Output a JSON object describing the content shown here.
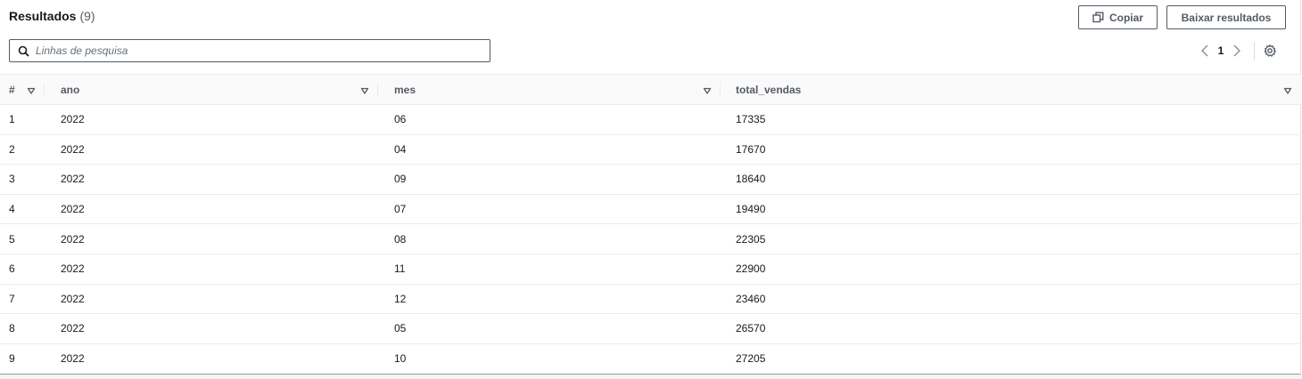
{
  "header": {
    "title": "Resultados",
    "count": "(9)",
    "copy_label": "Copiar",
    "download_label": "Baixar resultados"
  },
  "search": {
    "placeholder": "Linhas de pesquisa",
    "value": ""
  },
  "pagination": {
    "current_page": "1"
  },
  "table": {
    "columns": [
      "#",
      "ano",
      "mes",
      "total_vendas"
    ],
    "rows": [
      [
        "1",
        "2022",
        "06",
        "17335"
      ],
      [
        "2",
        "2022",
        "04",
        "17670"
      ],
      [
        "3",
        "2022",
        "09",
        "18640"
      ],
      [
        "4",
        "2022",
        "07",
        "19490"
      ],
      [
        "5",
        "2022",
        "08",
        "22305"
      ],
      [
        "6",
        "2022",
        "11",
        "22900"
      ],
      [
        "7",
        "2022",
        "12",
        "23460"
      ],
      [
        "8",
        "2022",
        "05",
        "26570"
      ],
      [
        "9",
        "2022",
        "10",
        "27205"
      ]
    ]
  },
  "icons": {
    "copy": "copy-icon",
    "search": "search-icon",
    "prev": "chevron-left-icon",
    "next": "chevron-right-icon",
    "settings": "gear-icon",
    "sort": "sort-down-icon"
  },
  "colors": {
    "text": "#16191f",
    "secondary_text": "#545b64",
    "border": "#eaeded"
  }
}
